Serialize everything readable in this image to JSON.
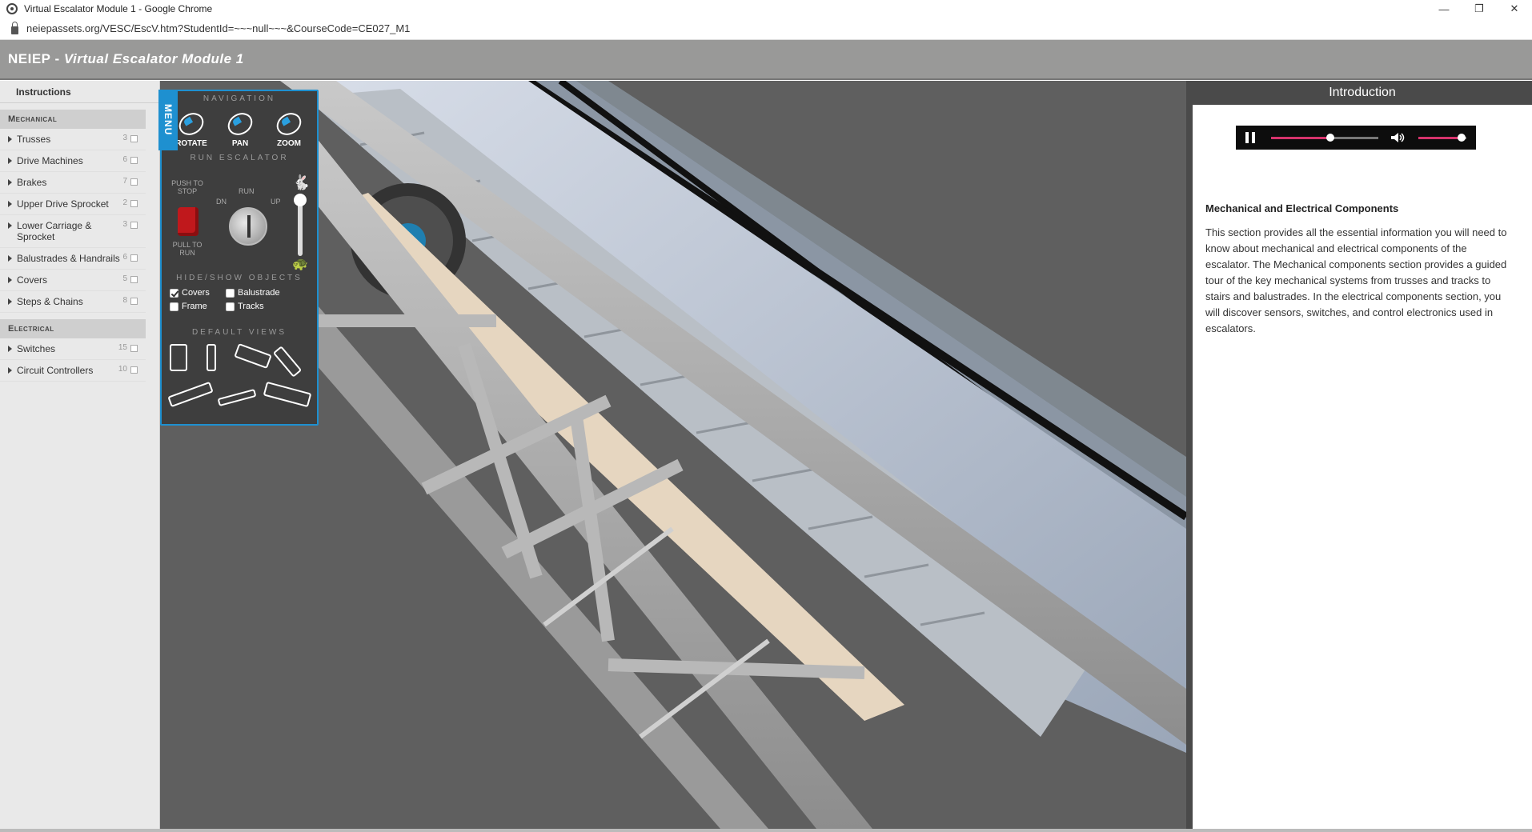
{
  "browser": {
    "window_title": "Virtual Escalator Module 1 - Google Chrome",
    "url": "neiepassets.org/VESC/EscV.htm?StudentId=~~~null~~~&CourseCode=CE027_M1"
  },
  "app": {
    "brand": "NEIEP",
    "separator": " - ",
    "module_title": "Virtual Escalator Module 1"
  },
  "sidebar": {
    "instructions": "Instructions",
    "mechanical_header": "Mechanical",
    "mechanical_items": [
      {
        "label": "Trusses",
        "count": "3"
      },
      {
        "label": "Drive Machines",
        "count": "6"
      },
      {
        "label": "Brakes",
        "count": "7"
      },
      {
        "label": "Upper Drive Sprocket",
        "count": "2"
      },
      {
        "label": "Lower Carriage & Sprocket",
        "count": "3"
      },
      {
        "label": "Balustrades & Handrails",
        "count": "6"
      },
      {
        "label": "Covers",
        "count": "5"
      },
      {
        "label": "Steps & Chains",
        "count": "8"
      }
    ],
    "electrical_header": "Electrical",
    "electrical_items": [
      {
        "label": "Switches",
        "count": "15"
      },
      {
        "label": "Circuit Controllers",
        "count": "10"
      }
    ]
  },
  "controls": {
    "menu_tab": "MENU",
    "navigation_header": "NAVIGATION",
    "nav_rotate": "ROTATE",
    "nav_pan": "PAN",
    "nav_zoom": "ZOOM",
    "run_header": "RUN ESCALATOR",
    "push_to_stop": "PUSH TO STOP",
    "pull_to_run": "PULL TO RUN",
    "key_run": "RUN",
    "key_dn": "DN",
    "key_up": "UP",
    "speed_level": 1.0,
    "hide_show_header": "HIDE/SHOW OBJECTS",
    "objects": [
      {
        "label": "Covers",
        "checked": true
      },
      {
        "label": "Balustrade",
        "checked": false
      },
      {
        "label": "Frame",
        "checked": false
      },
      {
        "label": "Tracks",
        "checked": false
      }
    ],
    "default_views_header": "DEFAULT VIEWS"
  },
  "panel": {
    "header": "Introduction",
    "player": {
      "progress": 0.55,
      "volume": 0.9
    },
    "title": "Mechanical and Electrical Components",
    "body": "This section provides all the essential information you will need to know about mechanical and electrical components of the escalator. The Mechanical components section provides a guided tour of the key mechanical systems from trusses and tracks to stairs and balustrades. In the electrical components section, you will discover sensors, switches, and control electronics used in escalators."
  },
  "colors": {
    "accent_blue": "#1e90d0",
    "media_pink": "#d6336c",
    "header_gray": "#999998"
  }
}
